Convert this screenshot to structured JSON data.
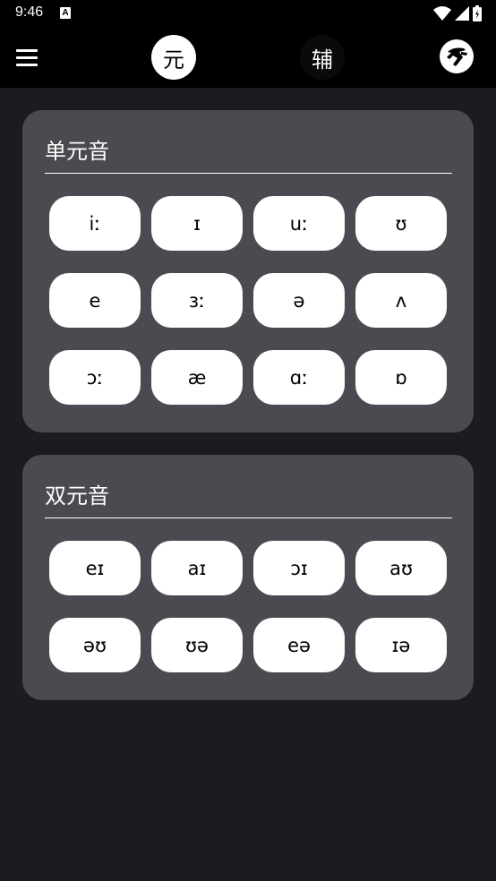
{
  "status_bar": {
    "time": "9:46",
    "notification_badge": "A"
  },
  "app_bar": {
    "tab_vowels": "元",
    "tab_consonants": "辅"
  },
  "monophthongs": {
    "title": "单元音",
    "keys": [
      "iː",
      "ɪ",
      "uː",
      "ʊ",
      "e",
      "ɜː",
      "ə",
      "ʌ",
      "ɔː",
      "æ",
      "ɑː",
      "ɒ"
    ]
  },
  "diphthongs": {
    "title": "双元音",
    "keys": [
      "eɪ",
      "aɪ",
      "ɔɪ",
      "aʊ",
      "əʊ",
      "ʊə",
      "eə",
      "ɪə"
    ]
  }
}
